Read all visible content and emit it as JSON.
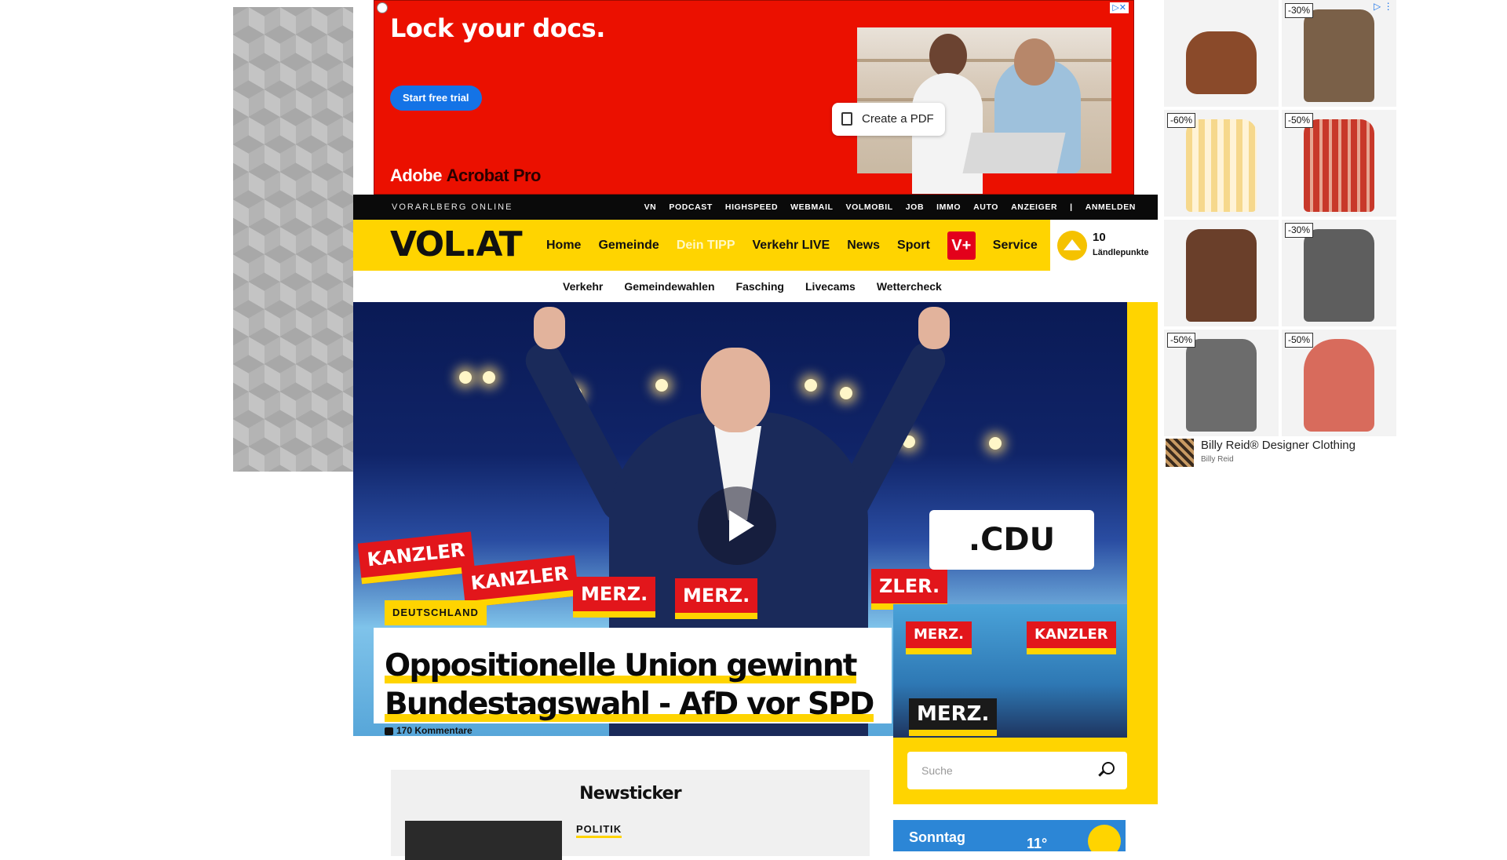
{
  "top_ad": {
    "headline": "Lock your docs.",
    "cta": "Start free trial",
    "chip": "Create a PDF",
    "brand_a": "Adobe",
    "brand_b": "Acrobat Pro",
    "choices": "▷✕"
  },
  "topbar": {
    "brand": "VORARLBERG ONLINE",
    "links": [
      "VN",
      "PODCAST",
      "HIGHSPEED",
      "WEBMAIL",
      "VOLMOBIL",
      "JOB",
      "IMMO",
      "AUTO",
      "ANZEIGER",
      "ANMELDEN"
    ],
    "separator": "|"
  },
  "nav": {
    "logo": "VOL.AT",
    "items": [
      "Home",
      "Gemeinde",
      "Dein TIPP",
      "Verkehr LIVE",
      "News",
      "Sport"
    ],
    "vplus": "V+",
    "service": "Service",
    "points_value": "10",
    "points_label": "Ländlepunkte"
  },
  "subnav": [
    "Verkehr",
    "Gemeindewahlen",
    "Fasching",
    "Livecams",
    "Wettercheck"
  ],
  "hero": {
    "signs": [
      "KANZLER",
      "KANZLER",
      "MERZ.",
      "MERZ.",
      "ZLER."
    ],
    "cdu": ".CDU"
  },
  "article": {
    "tag": "DEUTSCHLAND",
    "headline_line1": "Oppositionelle Union gewinnt",
    "headline_line2": "Bundestagswahl - AfD vor SPD",
    "comments": "170 Kommentare"
  },
  "side": {
    "search_placeholder": "Suche",
    "photo_signs": [
      "MERZ.",
      "KANZLER",
      "MERZ."
    ],
    "weather_day": "Sonntag",
    "weather_temp": "11°"
  },
  "ticker": {
    "title": "Newsticker",
    "category": "POLITIK"
  },
  "side_ad": {
    "discounts": [
      "-30%",
      "-60%",
      "-50%",
      "-30%",
      "-50%",
      "-50%"
    ],
    "title": "Billy Reid® Designer Clothing",
    "subtitle": "Billy Reid",
    "choices": "▷ ⋮"
  },
  "colors": {
    "brand_yellow": "#ffd400",
    "topbar_black": "#0a0a0a",
    "adobe_red": "#eb1000",
    "vplus_red": "#e3001b"
  }
}
